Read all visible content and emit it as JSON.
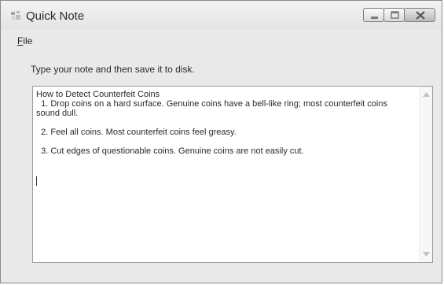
{
  "window": {
    "title": "Quick Note"
  },
  "menu": {
    "file_access_key": "F",
    "file_rest": "ile"
  },
  "form": {
    "instruction": "Type your note and then save it to disk.",
    "note_text": "How to Detect Counterfeit Coins\n  1. Drop coins on a hard surface. Genuine coins have a bell-like ring; most counterfeit coins sound dull.\n\n  2. Feel all coins. Most counterfeit coins feel greasy.\n\n  3. Cut edges of questionable coins. Genuine coins are not easily cut.\n"
  },
  "icons": {
    "app": "app-icon",
    "minimize": "minimize-icon",
    "maximize": "maximize-icon",
    "close": "close-icon",
    "scroll_up": "scroll-up-arrow-icon",
    "scroll_down": "scroll-down-arrow-icon"
  },
  "colors": {
    "window_bg": "#e9e9e9",
    "text_area_bg": "#ffffff",
    "border": "#9a9a9a"
  }
}
